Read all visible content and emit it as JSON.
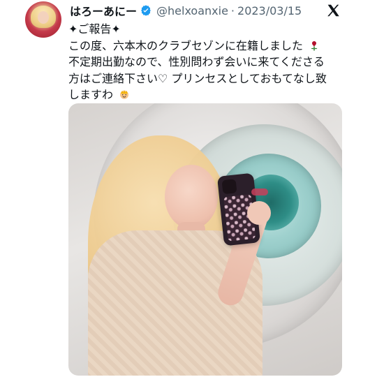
{
  "tweet": {
    "author": {
      "display_name": "はろーあにー",
      "handle": "@helxoanxie",
      "verified": true
    },
    "date": "2023/03/15",
    "platform_icon": "x-logo-icon",
    "text_lines": [
      "✦ご報告✦",
      "この度、六本木のクラブセゾンに在籍しました",
      "不定期出勤なので、性別問わず会いに来てくださる",
      "方はご連絡下さい♡ プリンセスとしておもてなし致",
      "しますわ"
    ],
    "emojis": {
      "line_2_end": "rose",
      "line_5_end": "princess"
    },
    "media": {
      "type": "photo",
      "alt": ""
    }
  },
  "colors": {
    "text_primary": "#0f1419",
    "text_secondary": "#536471",
    "verified_blue": "#1d9bf0"
  }
}
